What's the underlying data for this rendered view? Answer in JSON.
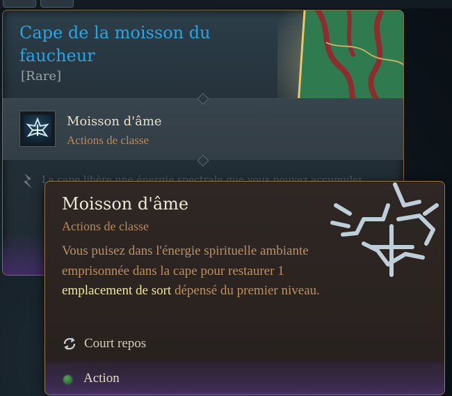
{
  "item": {
    "title": "Cape de la moisson du faucheur",
    "rarity": "[Rare]",
    "ability_name": "Moisson d'âme",
    "ability_category": "Actions de classe",
    "faded_description": "La cape libère une énergie spectrale que vous pouvez accumuler…"
  },
  "tooltip": {
    "name": "Moisson d'âme",
    "category": "Actions de classe",
    "description_before": "Vous puisez dans l'énergie spirituelle ambiante emprisonnée dans la cape pour restaurer 1 ",
    "description_highlight": "emplacement de sort",
    "description_after": " dépensé du premier niveau.",
    "recharge": "Court repos",
    "cost": "Action"
  },
  "colors": {
    "title": "#27a6e6",
    "category": "#b98a5c",
    "highlight": "#f2e6a4",
    "action_dot": "#3f8a45",
    "border": "#9c7a45"
  },
  "icons": [
    "soul-harvest-icon",
    "cape-icon",
    "bolt-icon",
    "short-rest-icon",
    "action-dot-icon"
  ]
}
